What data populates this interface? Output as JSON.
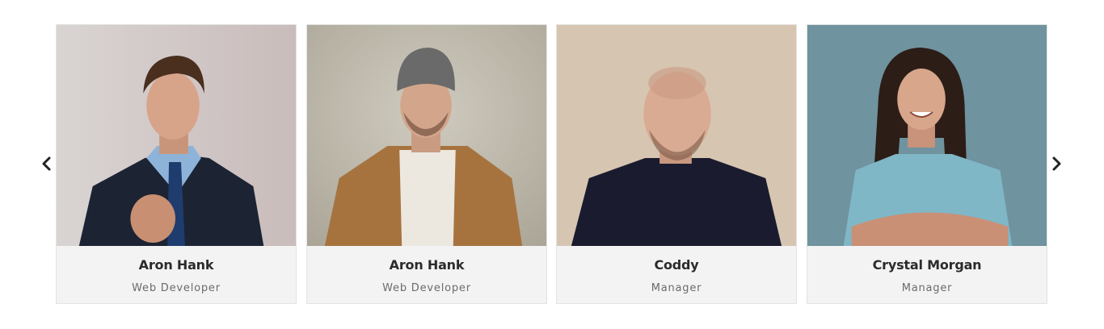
{
  "nav": {
    "prev_icon": "chevron-left-icon",
    "next_icon": "chevron-right-icon"
  },
  "team": [
    {
      "name": "Aron Hank",
      "role": "Web Developer"
    },
    {
      "name": "Aron Hank",
      "role": "Web Developer"
    },
    {
      "name": "Coddy",
      "role": "Manager"
    },
    {
      "name": "Crystal Morgan",
      "role": "Manager"
    }
  ]
}
